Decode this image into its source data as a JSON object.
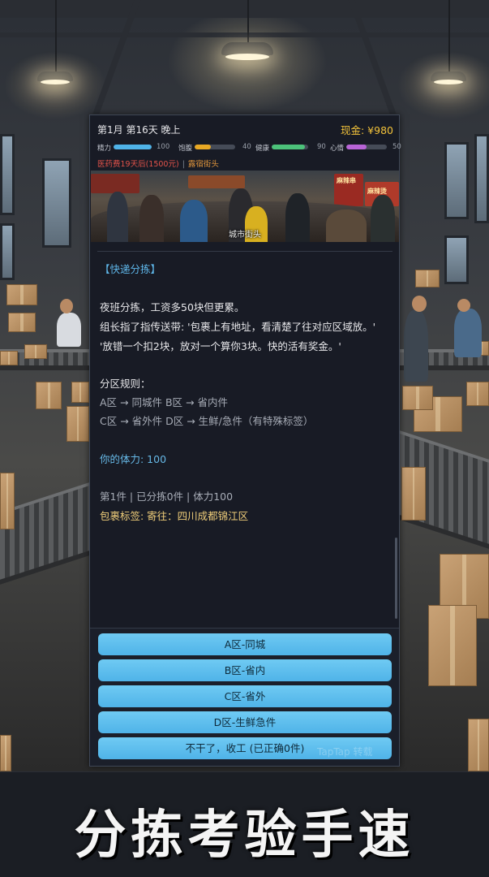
{
  "status": {
    "date": "第1月 第16天 晚上",
    "cash": "现金: ¥980"
  },
  "stats": [
    {
      "label": "精力",
      "value": "100",
      "level": 1.0,
      "color": "#4fb3e8"
    },
    {
      "label": "饱腹",
      "value": "40",
      "level": 0.4,
      "color": "#e8a824"
    },
    {
      "label": "健康",
      "value": "90",
      "level": 0.9,
      "color": "#4cc27a"
    },
    {
      "label": "心情",
      "value": "50",
      "level": 0.5,
      "color": "#b864d6"
    }
  ],
  "alerts": {
    "medical": "医药费19天后(1500元)",
    "separator": "|",
    "location": "露宿街头"
  },
  "scene": {
    "caption": "城市街头",
    "sign_1": "麻辣串",
    "sign_2": "麻辣烫"
  },
  "log": {
    "title": "【快递分拣】",
    "intro": "夜班分拣，工资多50块但更累。",
    "instruction_1": "组长指了指传送带: '包裹上有地址，看清楚了往对应区域放。'",
    "instruction_2": "'放错一个扣2块，放对一个算你3块。快的活有奖金。'",
    "rules_header": "分区规则：",
    "rule_1": "A区 → 同城件   B区 → 省内件",
    "rule_2": "C区 → 省外件   D区 → 生鲜/急件（有特殊标签）",
    "stamina": "你的体力: 100",
    "progress": "第1件 | 已分拣0件 | 体力100",
    "parcel_label": "包裹标签: 寄往：四川成都锦江区"
  },
  "choices": [
    "A区-同城",
    "B区-省内",
    "C区-省外",
    "D区-生鲜急件",
    "不干了，收工 (已正确0件)"
  ],
  "watermark": "TapTap 转载",
  "banner": {
    "title": "分拣考验手速"
  }
}
